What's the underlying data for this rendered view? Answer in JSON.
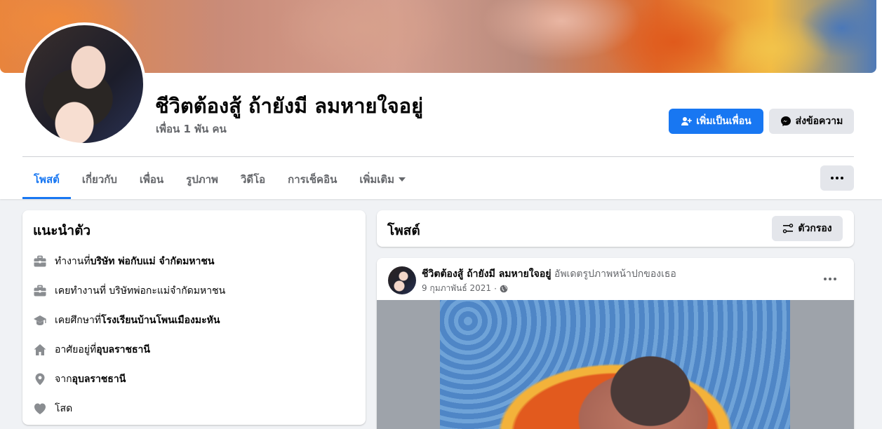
{
  "profile": {
    "name": "ชีวิตต้องสู้ ถ้ายังมี ลมหายใจอยู่",
    "friends": "เพื่อน 1 พัน คน"
  },
  "actions": {
    "add_friend": "เพิ่มเป็นเพื่อน",
    "message": "ส่งข้อความ"
  },
  "tabs": [
    {
      "label": "โพสต์"
    },
    {
      "label": "เกี่ยวกับ"
    },
    {
      "label": "เพื่อน"
    },
    {
      "label": "รูปภาพ"
    },
    {
      "label": "วิดีโอ"
    },
    {
      "label": "การเช็คอิน"
    },
    {
      "label": "เพิ่มเติม"
    }
  ],
  "intro": {
    "title": "แนะนำตัว",
    "items": [
      {
        "icon": "briefcase-icon",
        "prefix": "ทำงานที่ ",
        "value": "บริษัท พ่อกับแม่ จำกัดมหาชน"
      },
      {
        "icon": "briefcase-icon",
        "prefix": "เคยทำงานที่ บริษัทพ่อกะแม่จำกัดมหาชน",
        "value": ""
      },
      {
        "icon": "graduation-cap-icon",
        "prefix": "เคยศึกษาที่ ",
        "value": "โรงเรียนบ้านโพนเมืองมะหัน"
      },
      {
        "icon": "home-icon",
        "prefix": "อาศัยอยู่ที่ ",
        "value": "อุบลราชธานี"
      },
      {
        "icon": "location-pin-icon",
        "prefix": "จาก ",
        "value": "อุบลราชธานี"
      },
      {
        "icon": "heart-icon",
        "prefix": "โสด",
        "value": ""
      }
    ]
  },
  "posts": {
    "title": "โพสต์",
    "filter_label": "ตัวกรอง"
  },
  "post": {
    "author": "ชีวิตต้องสู้ ถ้ายังมี ลมหายใจอยู่",
    "action": "อัพเดตรูปภาพหน้าปกของเธอ",
    "date": "9 กุมภาพันธ์ 2021",
    "separator": "·",
    "audience_icon": "globe-icon"
  },
  "colors": {
    "accent": "#1877f2",
    "secondary_text": "#65676b",
    "background": "#f0f2f5"
  }
}
